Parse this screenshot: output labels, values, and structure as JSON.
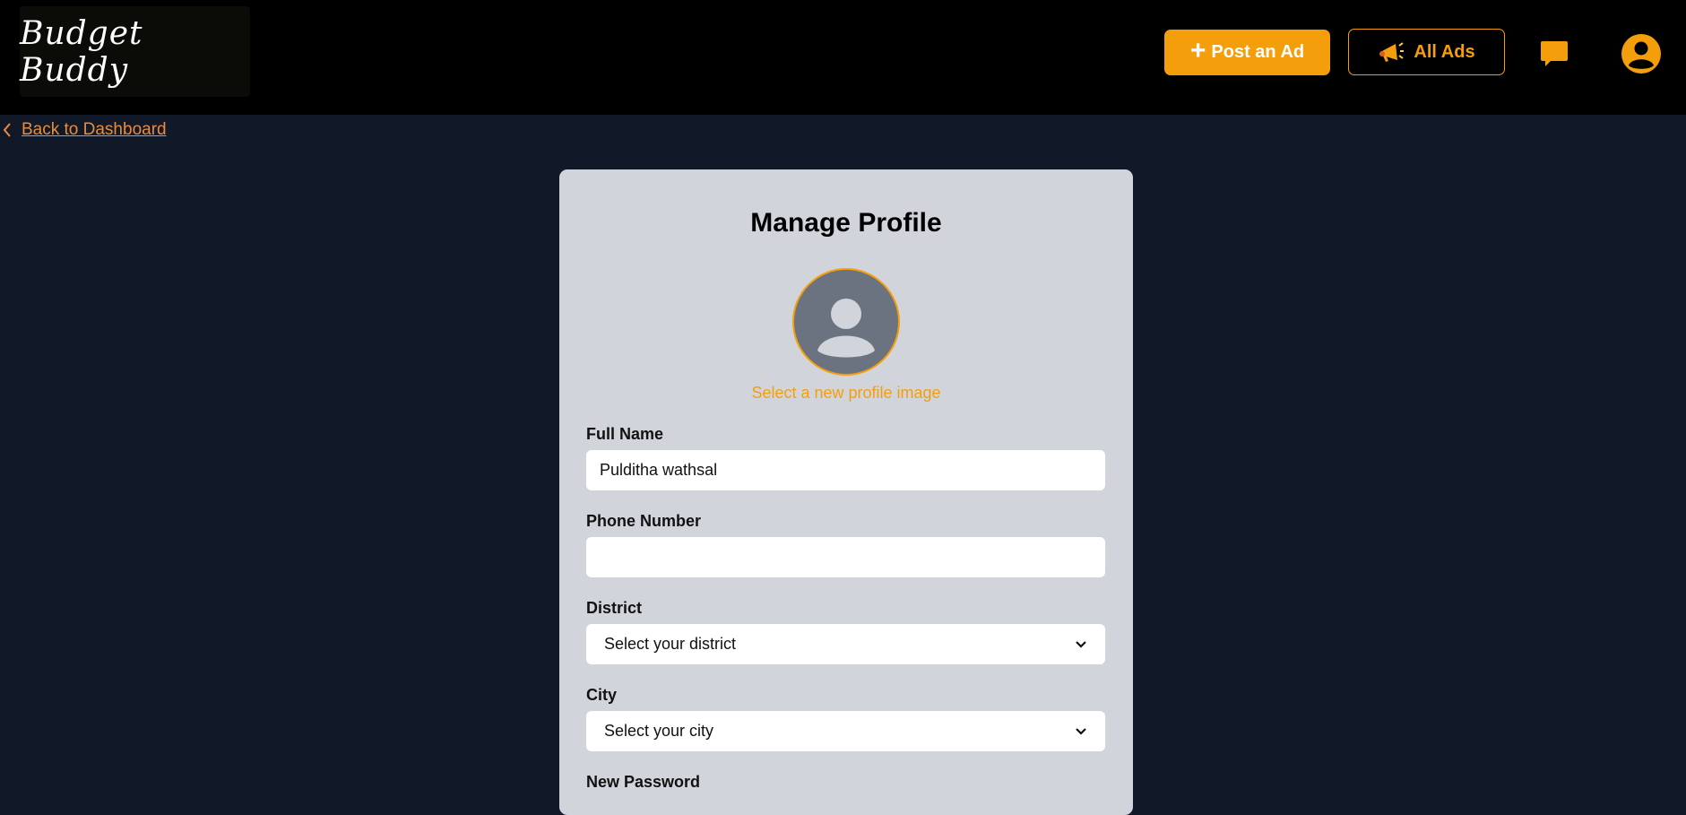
{
  "header": {
    "logo_text": "Budget Buddy",
    "post_ad_label": "Post an Ad",
    "all_ads_label": "All Ads"
  },
  "nav": {
    "back_label": "Back to Dashboard"
  },
  "profile": {
    "title": "Manage Profile",
    "select_image_label": "Select a new profile image",
    "fields": {
      "full_name_label": "Full Name",
      "full_name_value": "Pulditha wathsal",
      "phone_label": "Phone Number",
      "phone_value": "",
      "district_label": "District",
      "district_selected": "Select your district",
      "city_label": "City",
      "city_selected": "Select your city",
      "new_password_label": "New Password"
    }
  },
  "colors": {
    "accent": "#f59e0b",
    "page_bg": "#111827",
    "header_bg": "#000000",
    "card_bg": "#d1d5db",
    "avatar_bg": "#6b7280"
  },
  "icons": {
    "plus": "plus-icon",
    "megaphone": "megaphone-icon",
    "chat": "chat-bubble-icon",
    "user": "user-circle-icon",
    "back": "chevron-left-icon",
    "dropdown": "chevron-down-icon"
  }
}
